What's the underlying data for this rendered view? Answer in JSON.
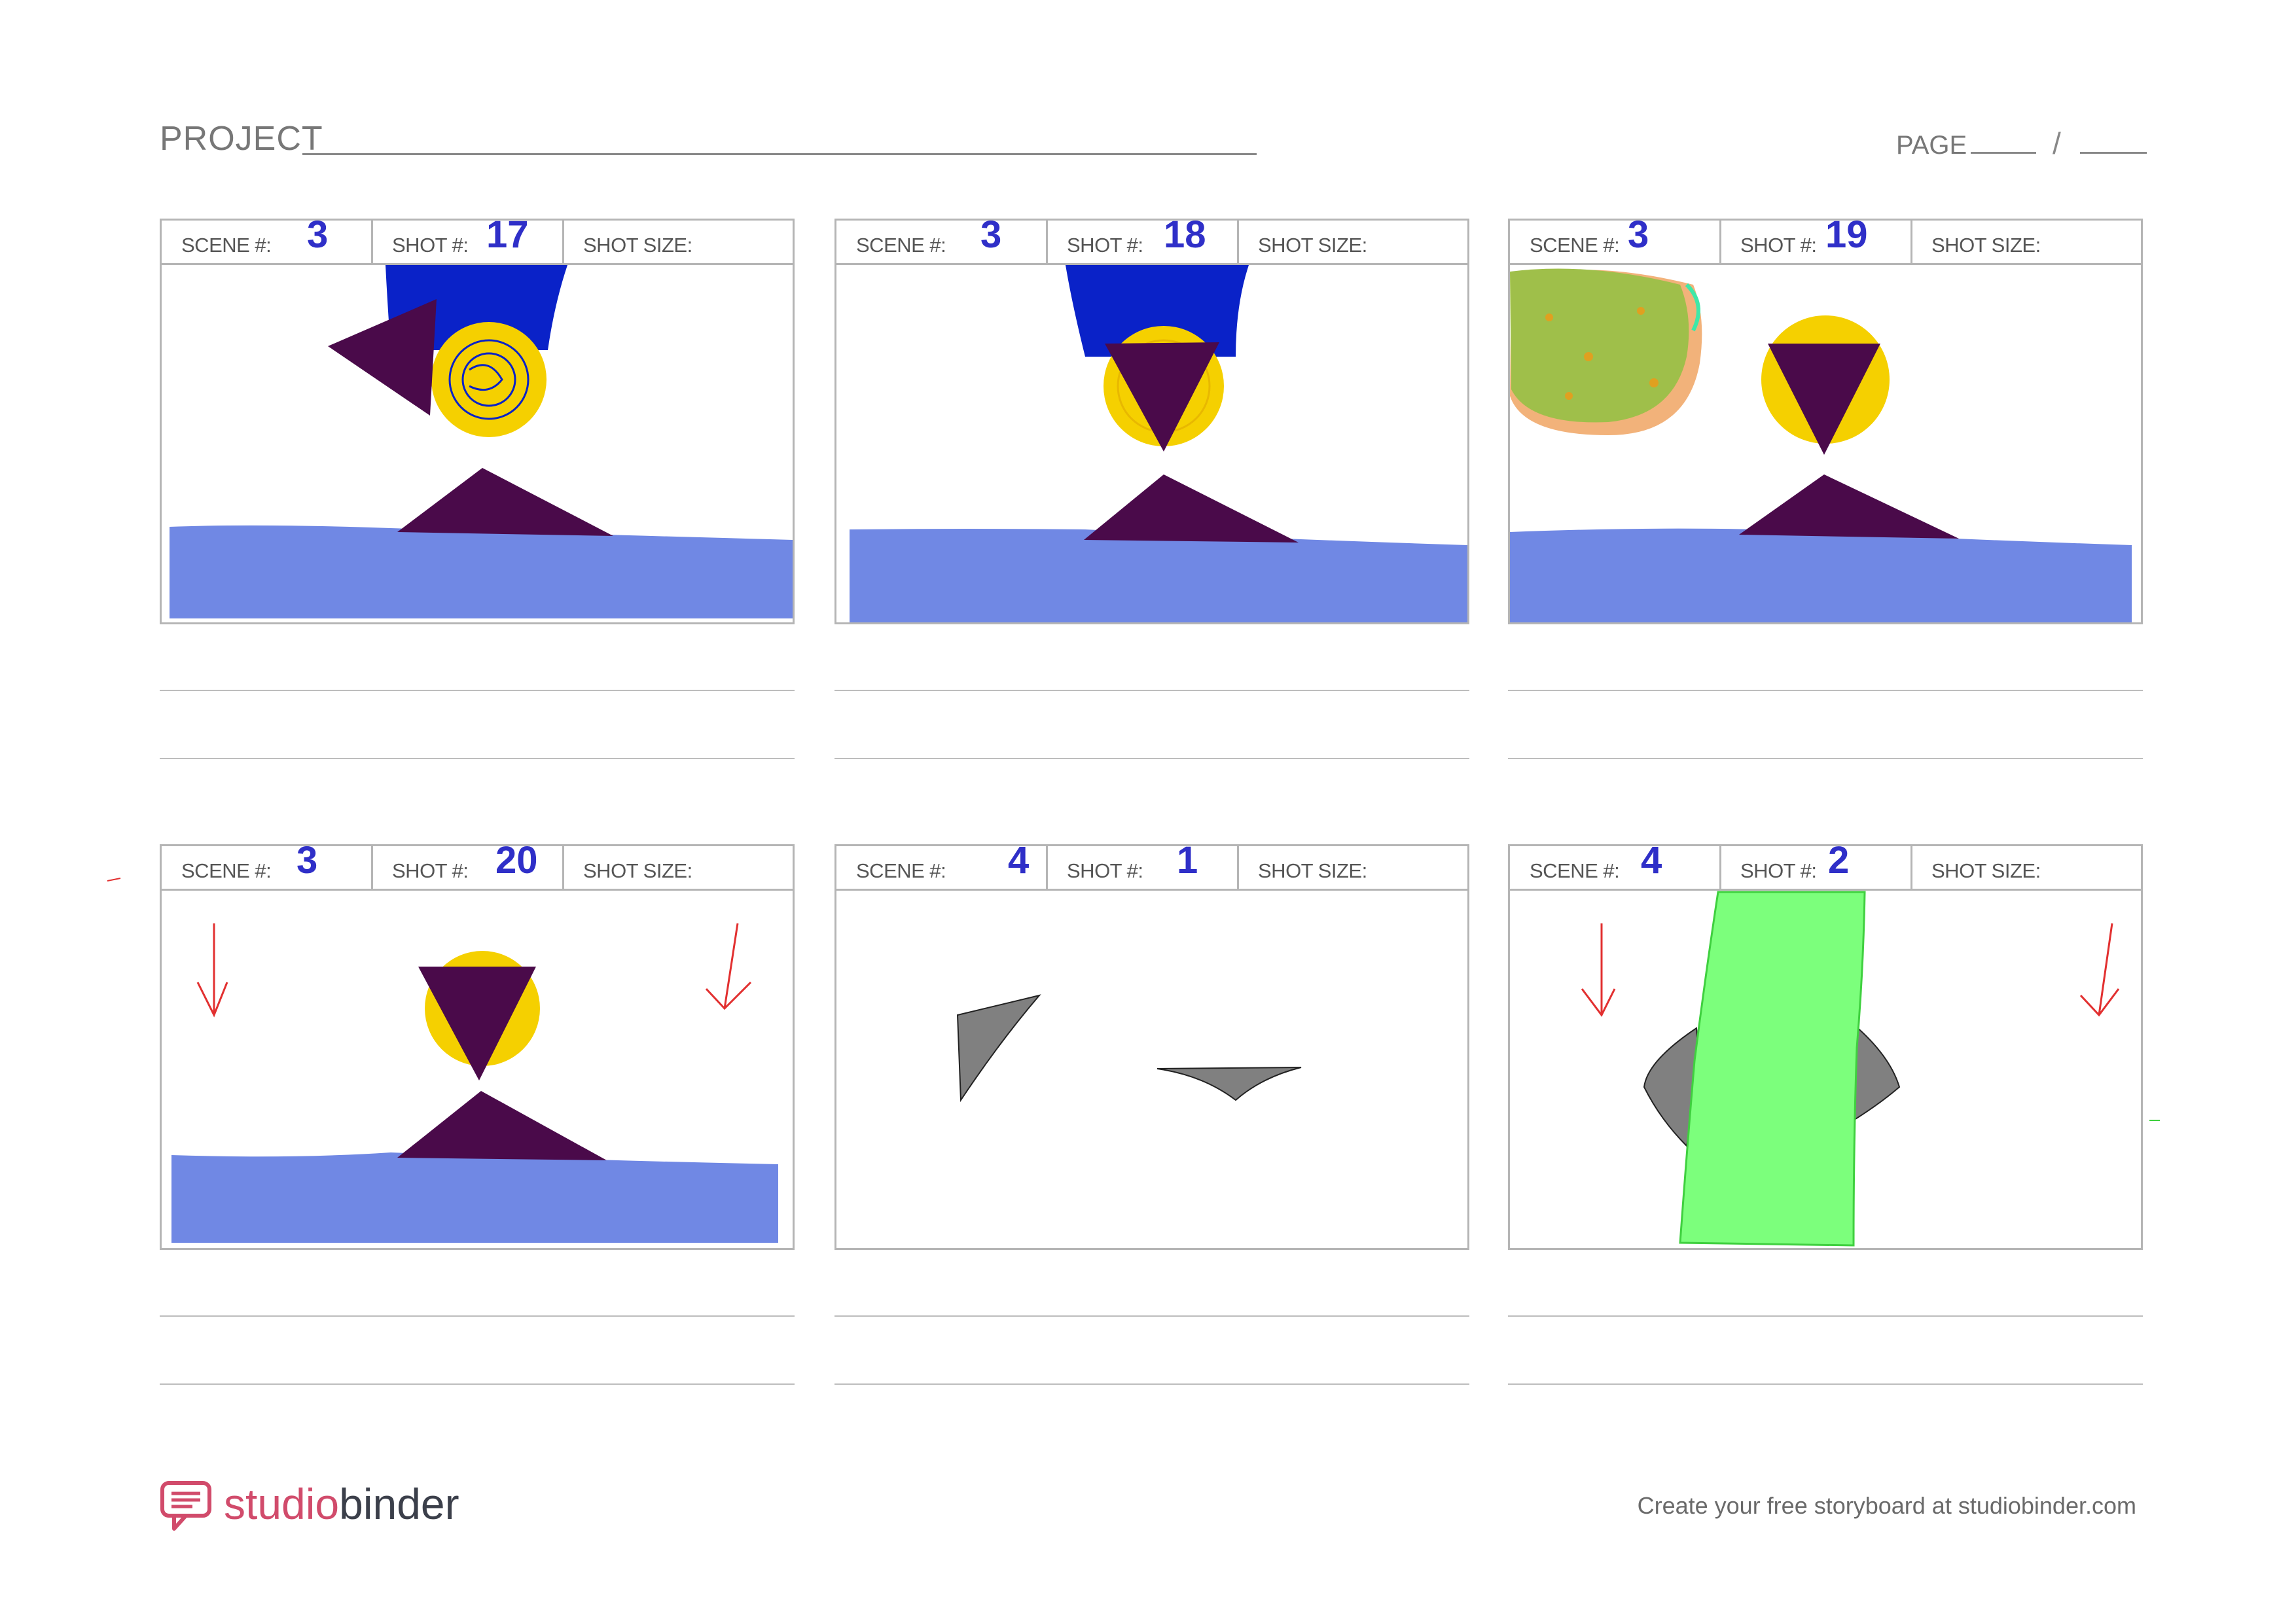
{
  "header": {
    "project_label": "PROJECT",
    "page_label": "PAGE",
    "page_separator": "/"
  },
  "labels": {
    "scene": "SCENE #:",
    "shot": "SHOT #:",
    "shot_size": "SHOT SIZE:"
  },
  "panels": [
    {
      "scene": "3",
      "shot": "17",
      "shot_size": ""
    },
    {
      "scene": "3",
      "shot": "18",
      "shot_size": ""
    },
    {
      "scene": "3",
      "shot": "19",
      "shot_size": ""
    },
    {
      "scene": "3",
      "shot": "20",
      "shot_size": ""
    },
    {
      "scene": "4",
      "shot": "1",
      "shot_size": ""
    },
    {
      "scene": "4",
      "shot": "2",
      "shot_size": ""
    }
  ],
  "footer": {
    "brand_part1": "studio",
    "brand_part2": "binder",
    "cta": "Create your free storyboard at studiobinder.com"
  },
  "colors": {
    "handwriting": "#2f2fc8",
    "water": "#7088e4",
    "purple": "#4a0a4a",
    "yellow": "#f5d000",
    "blue": "#0a22c8",
    "green": "#7cff7c",
    "brand": "#d14b6b"
  }
}
